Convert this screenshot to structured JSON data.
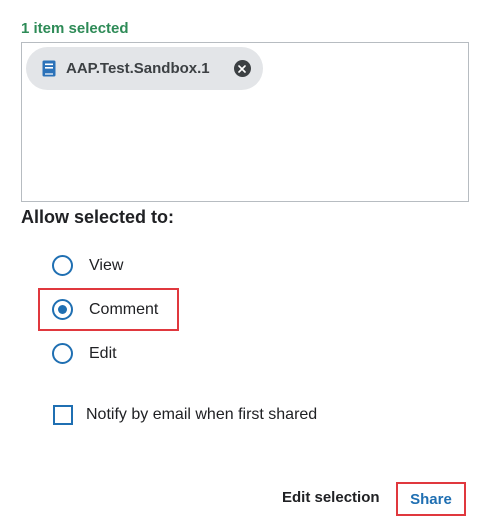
{
  "selection": {
    "count_text": "1 item selected",
    "chip": {
      "label": "AAP.Test.Sandbox.1",
      "icon": "notebook-icon",
      "remove_icon": "close-circle-icon"
    }
  },
  "permissions": {
    "heading": "Allow selected to:",
    "selected": "Comment",
    "options": [
      {
        "label": "View",
        "checked": false
      },
      {
        "label": "Comment",
        "checked": true
      },
      {
        "label": "Edit",
        "checked": false
      }
    ]
  },
  "notify": {
    "label": "Notify by email when first shared",
    "checked": false
  },
  "actions": {
    "edit_label": "Edit selection",
    "share_label": "Share"
  },
  "colors": {
    "accent": "#1f6fb2",
    "success_text": "#2e8b57",
    "highlight": "#e0383e",
    "chip_bg": "#e3e5e8"
  }
}
